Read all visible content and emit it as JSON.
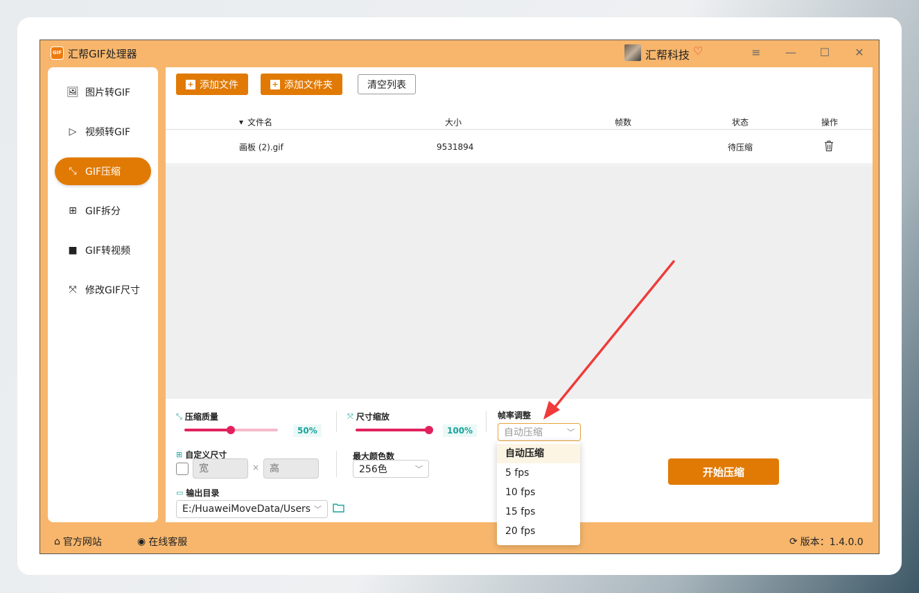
{
  "app": {
    "title": "汇帮GIF处理器",
    "logo_text": "GIF",
    "brand": "汇帮科技"
  },
  "window_controls": {
    "menu": "≡",
    "minimize": "—",
    "maximize": "☐",
    "close": "✕"
  },
  "sidebar": {
    "items": [
      {
        "label": "图片转GIF",
        "icon": "image-icon"
      },
      {
        "label": "视频转GIF",
        "icon": "play-icon"
      },
      {
        "label": "GIF压缩",
        "icon": "compress-icon",
        "active": true
      },
      {
        "label": "GIF拆分",
        "icon": "split-icon"
      },
      {
        "label": "GIF转视频",
        "icon": "video-camera-icon"
      },
      {
        "label": "修改GIF尺寸",
        "icon": "resize-icon"
      }
    ]
  },
  "toolbar": {
    "add_file": "添加文件",
    "add_folder": "添加文件夹",
    "clear_list": "清空列表"
  },
  "table": {
    "headers": {
      "filename": "文件名",
      "size": "大小",
      "frames": "帧数",
      "status": "状态",
      "action": "操作"
    },
    "rows": [
      {
        "filename": "画板 (2).gif",
        "size": "9531894",
        "frames": "",
        "status": "待压缩"
      }
    ]
  },
  "settings": {
    "quality": {
      "label": "压缩质量",
      "value": 50,
      "display": "50%"
    },
    "scale": {
      "label": "尺寸缩放",
      "value": 100,
      "display": "100%"
    },
    "frame_rate": {
      "label": "帧率调整",
      "selected": "自动压缩",
      "options": [
        "自动压缩",
        "5 fps",
        "10 fps",
        "15 fps",
        "20 fps"
      ]
    },
    "custom_size": {
      "label": "自定义尺寸",
      "width_placeholder": "宽",
      "height_placeholder": "高",
      "separator": "×"
    },
    "max_colors": {
      "label": "最大颜色数",
      "selected": "256色"
    },
    "output_dir": {
      "label": "输出目录",
      "value": "E:/HuaweiMoveData/Users"
    },
    "start_button": "开始压缩"
  },
  "footer": {
    "official_site": "官方网站",
    "online_service": "在线客服",
    "version": "版本：1.4.0.0"
  },
  "colors": {
    "accent": "#e17a04",
    "frame": "#f7b66c",
    "teal": "#1aa39a",
    "slider": "#e2225d",
    "arrow": "#ef3b3b"
  }
}
